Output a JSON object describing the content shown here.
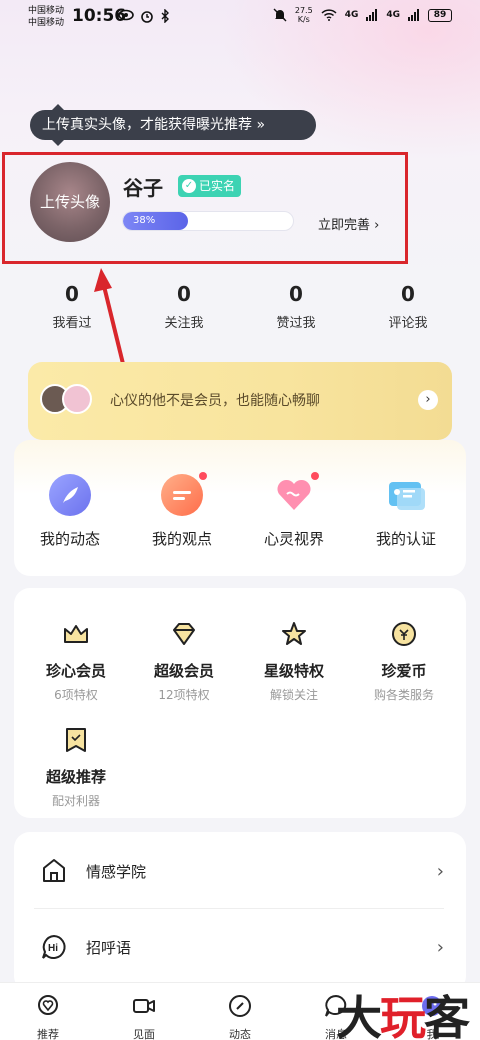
{
  "status_bar": {
    "carrier1": "中国移动",
    "carrier2": "中国移动",
    "time": "10:56",
    "speed_value": "27.5",
    "speed_unit": "K/s",
    "signal1": "4G",
    "signal2": "4G",
    "battery": "89"
  },
  "tooltip": {
    "text": "上传真实头像，才能获得曝光推荐 »"
  },
  "profile": {
    "avatar_label": "上传头像",
    "username": "谷子",
    "verified_label": "已实名",
    "progress_text": "38%",
    "progress_fraction": 0.38,
    "complete_label": "立即完善 ›"
  },
  "stats": [
    {
      "value": "0",
      "label": "我看过"
    },
    {
      "value": "0",
      "label": "关注我"
    },
    {
      "value": "0",
      "label": "赞过我"
    },
    {
      "value": "0",
      "label": "评论我"
    }
  ],
  "vip_banner": {
    "text": "心仪的他不是会员，也能随心畅聊",
    "arrow": "›"
  },
  "features": [
    {
      "label": "我的动态",
      "icon": "feather-icon",
      "color": "#7d7ff0",
      "dot": false
    },
    {
      "label": "我的观点",
      "icon": "chat-bubble-icon",
      "color": "#ff8a5c",
      "dot": true
    },
    {
      "label": "心灵视界",
      "icon": "heart-icon",
      "color": "#ff7fa0",
      "dot": true
    },
    {
      "label": "我的认证",
      "icon": "id-card-icon",
      "color": "#4fb8ee",
      "dot": false
    }
  ],
  "privileges": [
    {
      "title": "珍心会员",
      "sub": "6项特权",
      "icon": "crown-icon"
    },
    {
      "title": "超级会员",
      "sub": "12项特权",
      "icon": "diamond-icon"
    },
    {
      "title": "星级特权",
      "sub": "解锁关注",
      "icon": "star-icon"
    },
    {
      "title": "珍爱币",
      "sub": "购各类服务",
      "icon": "coin-icon"
    },
    {
      "title": "超级推荐",
      "sub": "配对利器",
      "icon": "bookmark-icon"
    }
  ],
  "list": [
    {
      "label": "情感学院",
      "icon": "house-icon"
    },
    {
      "label": "招呼语",
      "icon": "hi-bubble-icon"
    }
  ],
  "bottom_nav": [
    {
      "label": "推荐",
      "icon": "heart-bubble-icon"
    },
    {
      "label": "见面",
      "icon": "video-icon"
    },
    {
      "label": "动态",
      "icon": "compass-icon"
    },
    {
      "label": "消息",
      "icon": "message-icon"
    },
    {
      "label": "我",
      "icon": "profile-icon"
    }
  ],
  "watermark": {
    "text1": "大",
    "text2": "玩",
    "text3": "客"
  },
  "colors": {
    "accent": "#5b64e8",
    "verified": "#3dd3b3",
    "highlight": "#d9262c",
    "vip": "#f8e49e"
  }
}
